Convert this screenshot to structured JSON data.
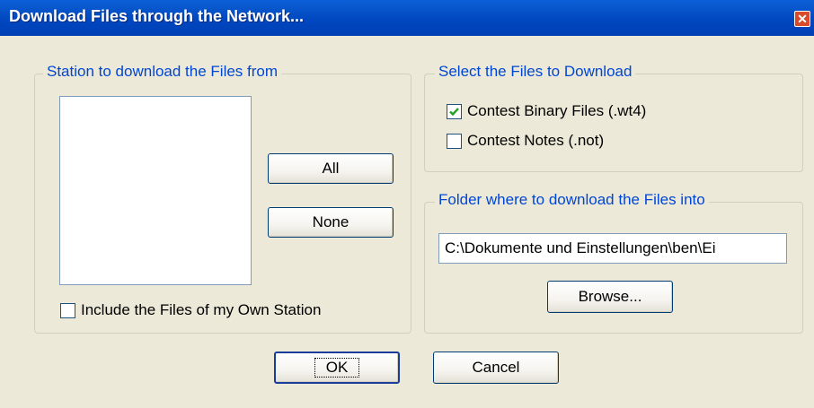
{
  "window": {
    "title": "Download Files through the Network...",
    "close_glyph": "✕"
  },
  "station_group": {
    "label": "Station to download the Files from",
    "all_button": "All",
    "none_button": "None",
    "include_own_label": "Include the Files of my Own Station",
    "include_own_checked": false
  },
  "files_group": {
    "label": "Select the Files to Download",
    "options": [
      {
        "label": "Contest Binary Files (.wt4)",
        "checked": true
      },
      {
        "label": "Contest Notes (.not)",
        "checked": false
      }
    ]
  },
  "folder_group": {
    "label": "Folder where to download the Files into",
    "path_value": "C:\\Dokumente und Einstellungen\\ben\\Ei",
    "browse_button": "Browse..."
  },
  "footer": {
    "ok_button": "OK",
    "cancel_button": "Cancel"
  },
  "colors": {
    "title_bar": "#0047c0",
    "group_label": "#0046d5",
    "check_mark": "#21a121"
  },
  "icons": {
    "close": "close-icon",
    "check": "checkmark-icon"
  }
}
